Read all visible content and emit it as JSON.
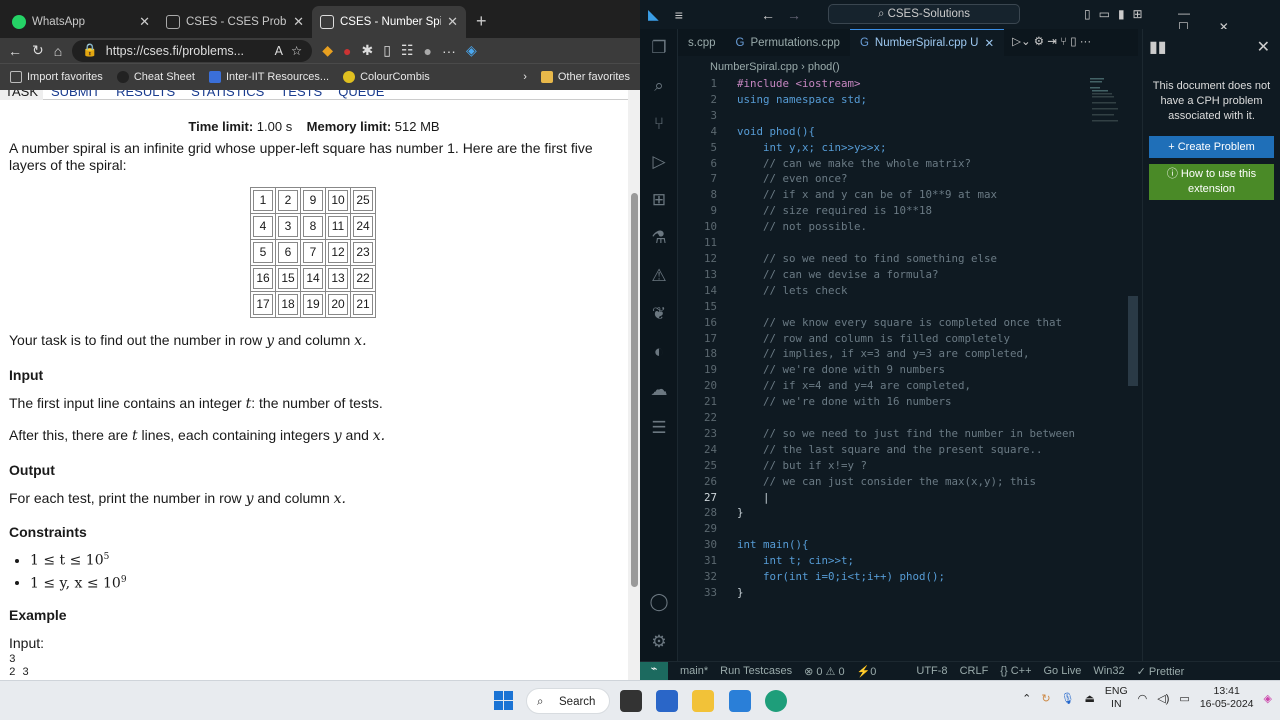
{
  "browser": {
    "tabs": [
      {
        "label": "WhatsApp",
        "color": "#25d366"
      },
      {
        "label": "CSES - CSES Problem",
        "color": "#888"
      },
      {
        "label": "CSES - Number Spiral",
        "color": "#fff"
      }
    ],
    "url": "https://cses.fi/problems...",
    "bookmarks": [
      "Import favorites",
      "Cheat Sheet",
      "Inter-IIT Resources...",
      "ColourCombis"
    ],
    "other_favorites": "Other favorites",
    "nav": [
      "TASK",
      "SUBMIT",
      "RESULTS",
      "STATISTICS",
      "TESTS",
      "QUEUE"
    ],
    "time_limit_label": "Time limit:",
    "time_limit": "1.00 s",
    "memory_limit_label": "Memory limit:",
    "memory_limit": "512 MB",
    "intro": "A number spiral is an infinite grid whose upper-left square has number 1. Here are the first five layers of the spiral:",
    "spiral": [
      [
        "1",
        "2",
        "9",
        "10",
        "25"
      ],
      [
        "4",
        "3",
        "8",
        "11",
        "24"
      ],
      [
        "5",
        "6",
        "7",
        "12",
        "23"
      ],
      [
        "16",
        "15",
        "14",
        "13",
        "22"
      ],
      [
        "17",
        "18",
        "19",
        "20",
        "21"
      ]
    ],
    "task": "Your task is to find out the number in row",
    "task_y": "y",
    "task_and": "and column",
    "task_x": "x.",
    "input_h": "Input",
    "input1": "The first input line contains an integer",
    "input1_t": "t",
    "input1_end": ": the number of tests.",
    "input2": "After this, there are",
    "input2_t": "t",
    "input2_mid": "lines, each containing integers",
    "input2_y": "y",
    "input2_and": "and",
    "input2_x": "x.",
    "output_h": "Output",
    "output1": "For each test, print the number in row",
    "output1_y": "y",
    "output1_and": "and column",
    "output1_x": "x.",
    "constraints_h": "Constraints",
    "c1": "1 ≤ t ≤ 10",
    "c1_exp": "5",
    "c2": "1 ≤ y, x ≤ 10",
    "c2_exp": "9",
    "example_h": "Example",
    "input_label": "Input:",
    "example_lines": [
      "3",
      "2 3"
    ]
  },
  "vscode": {
    "search": "CSES-Solutions",
    "tabs": [
      "s.cpp",
      "Permutations.cpp",
      "NumberSpiral.cpp U"
    ],
    "crumb_file": "NumberSpiral.cpp",
    "crumb_fn": "phod()",
    "lines": [
      "#include <iostream>",
      "using namespace std;",
      "",
      "void phod(){",
      "    int y,x; cin>>y>>x;",
      "    // can we make the whole matrix?",
      "    // even once?",
      "    // if x and y can be of 10**9 at max",
      "    // size required is 10**18",
      "    // not possible.",
      "",
      "    // so we need to find something else",
      "    // can we devise a formula?",
      "    // lets check",
      "",
      "    // we know every square is completed once that",
      "    // row and column is filled completely",
      "    // implies, if x=3 and y=3 are completed,",
      "    // we're done with 9 numbers",
      "    // if x=4 and y=4 are completed,",
      "    // we're done with 16 numbers",
      "",
      "    // so we need to just find the number in between",
      "    // the last square and the present square..",
      "    // but if x!=y ?",
      "    // we can just consider the max(x,y); this",
      "    |",
      "}",
      "",
      "int main(){",
      "    int t; cin>>t;",
      "    for(int i=0;i<t;i++) phod();",
      "}"
    ],
    "cph_msg": "This document does not have a CPH problem associated with it.",
    "cph_create": "Create Problem",
    "cph_help": "How to use this extension",
    "status": [
      "main*",
      "Run Testcases",
      "⊗ 0 ⚠ 0",
      "⚡0",
      "UTF-8",
      "CRLF",
      "{} C++",
      "Go Live",
      "Win32",
      "✓ Prettier"
    ]
  },
  "taskbar": {
    "search": "Search",
    "lang": [
      "ENG",
      "IN"
    ],
    "time": "13:41",
    "date": "16-05-2024"
  }
}
